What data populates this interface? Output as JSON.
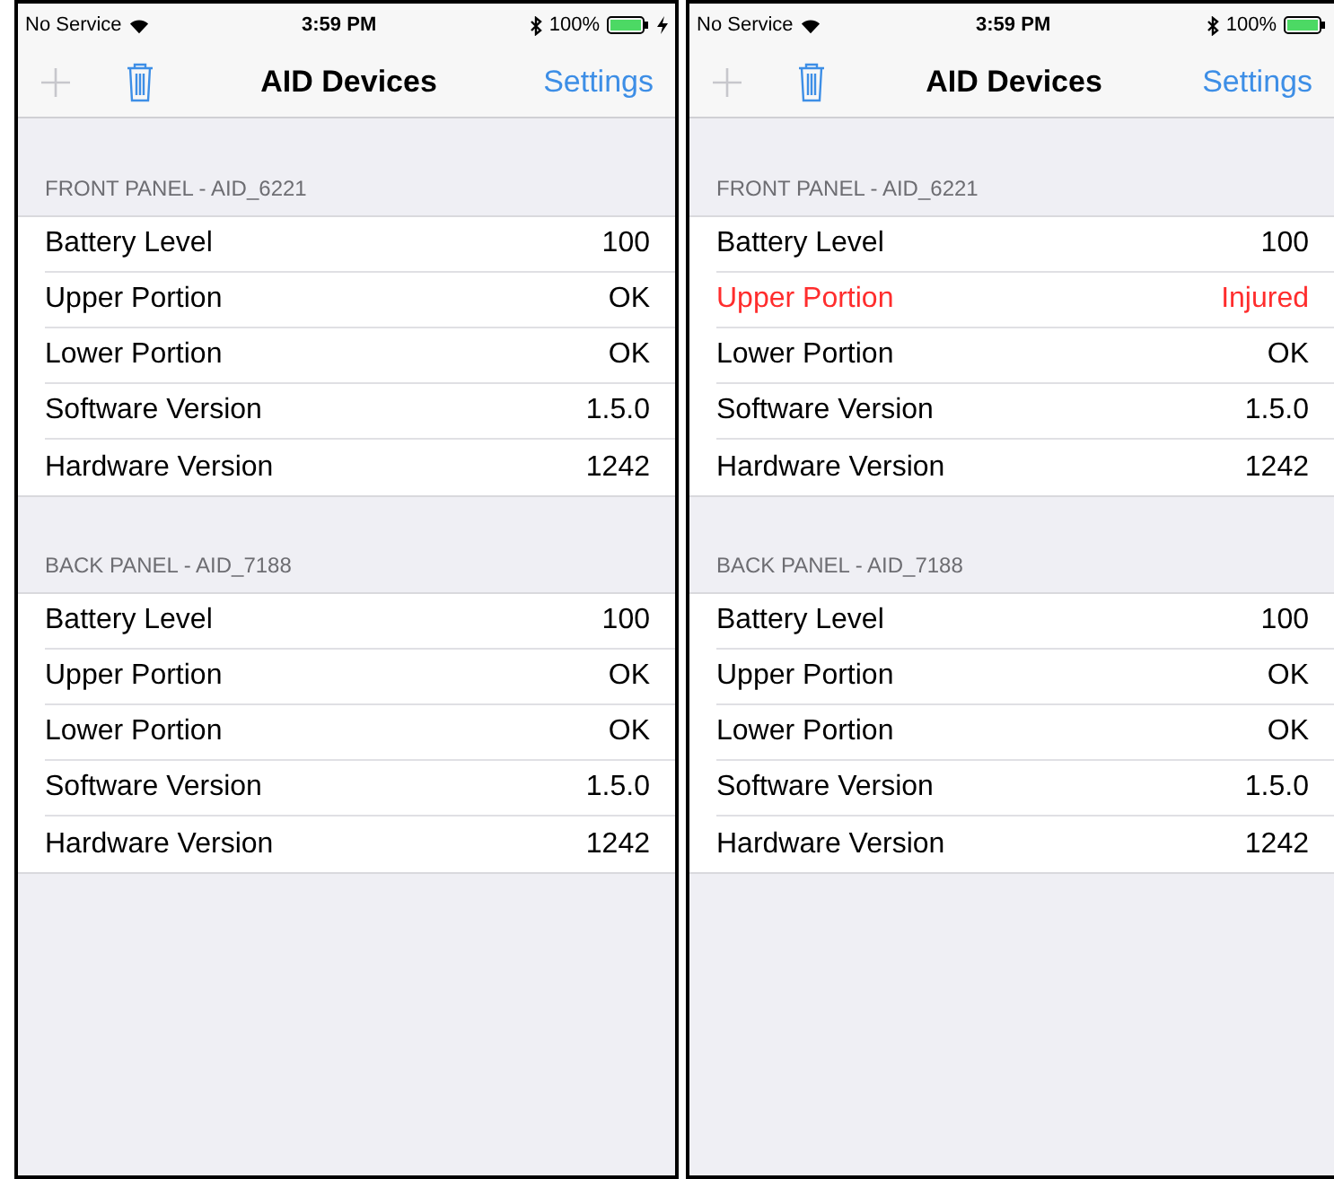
{
  "screens": [
    {
      "status_bar": {
        "carrier": "No Service",
        "time": "3:59 PM",
        "battery": "100%",
        "charging": true
      },
      "nav": {
        "title": "AID Devices",
        "settings": "Settings"
      },
      "sections": [
        {
          "header": "FRONT PANEL - AID_6221",
          "rows": [
            {
              "label": "Battery Level",
              "value": "100",
              "alert": false
            },
            {
              "label": "Upper Portion",
              "value": "OK",
              "alert": false
            },
            {
              "label": "Lower Portion",
              "value": "OK",
              "alert": false
            },
            {
              "label": "Software Version",
              "value": "1.5.0",
              "alert": false
            },
            {
              "label": "Hardware Version",
              "value": "1242",
              "alert": false
            }
          ]
        },
        {
          "header": "BACK PANEL - AID_7188",
          "rows": [
            {
              "label": "Battery Level",
              "value": "100",
              "alert": false
            },
            {
              "label": "Upper Portion",
              "value": "OK",
              "alert": false
            },
            {
              "label": "Lower Portion",
              "value": "OK",
              "alert": false
            },
            {
              "label": "Software Version",
              "value": "1.5.0",
              "alert": false
            },
            {
              "label": "Hardware Version",
              "value": "1242",
              "alert": false
            }
          ]
        }
      ]
    },
    {
      "status_bar": {
        "carrier": "No Service",
        "time": "3:59 PM",
        "battery": "100%"
      },
      "nav": {
        "title": "AID Devices",
        "settings": "Settings"
      },
      "sections": [
        {
          "header": "FRONT PANEL - AID_6221",
          "rows": [
            {
              "label": "Battery Level",
              "value": "100",
              "alert": false
            },
            {
              "label": "Upper Portion",
              "value": "Injured",
              "alert": true
            },
            {
              "label": "Lower Portion",
              "value": "OK",
              "alert": false
            },
            {
              "label": "Software Version",
              "value": "1.5.0",
              "alert": false
            },
            {
              "label": "Hardware Version",
              "value": "1242",
              "alert": false
            }
          ]
        },
        {
          "header": "BACK PANEL - AID_7188",
          "rows": [
            {
              "label": "Battery Level",
              "value": "100",
              "alert": false
            },
            {
              "label": "Upper Portion",
              "value": "OK",
              "alert": false
            },
            {
              "label": "Lower Portion",
              "value": "OK",
              "alert": false
            },
            {
              "label": "Software Version",
              "value": "1.5.0",
              "alert": false
            },
            {
              "label": "Hardware Version",
              "value": "1242",
              "alert": false
            }
          ]
        }
      ]
    }
  ]
}
